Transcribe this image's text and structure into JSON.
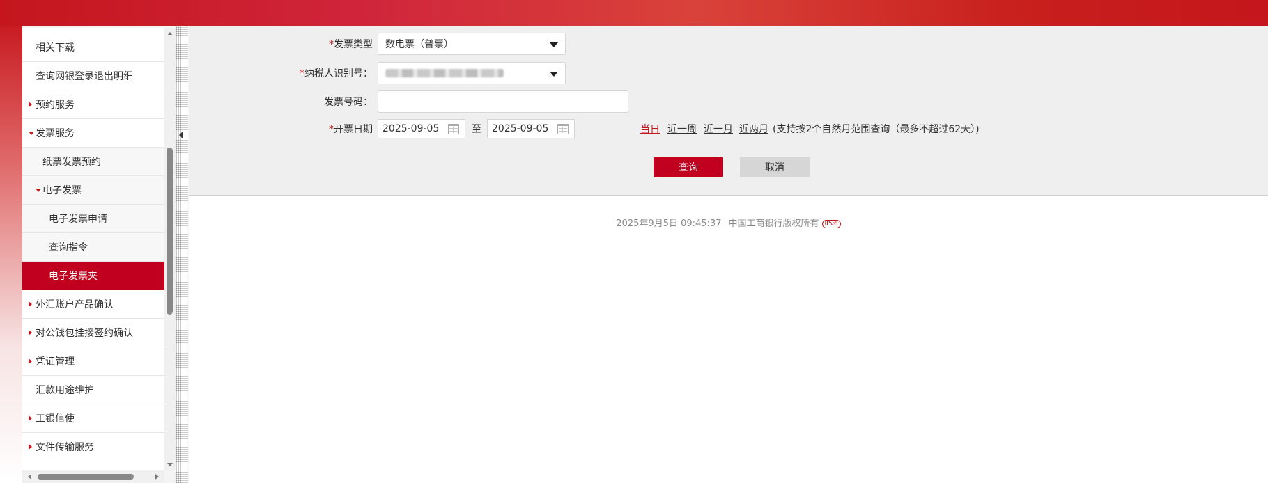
{
  "sidebar": {
    "items": [
      {
        "label": "相关下载",
        "arrow": "none",
        "level": 0
      },
      {
        "label": "查询网银登录退出明细",
        "arrow": "none",
        "level": 0
      },
      {
        "label": "预约服务",
        "arrow": "right",
        "level": 0
      },
      {
        "label": "发票服务",
        "arrow": "down",
        "level": 0
      },
      {
        "label": "纸票发票预约",
        "arrow": "none",
        "level": 1
      },
      {
        "label": "电子发票",
        "arrow": "down",
        "level": 1
      },
      {
        "label": "电子发票申请",
        "arrow": "none",
        "level": 2
      },
      {
        "label": "查询指令",
        "arrow": "none",
        "level": 2
      },
      {
        "label": "电子发票夹",
        "arrow": "none",
        "level": 2,
        "active": true
      },
      {
        "label": "外汇账户产品确认",
        "arrow": "right",
        "level": 0
      },
      {
        "label": "对公钱包挂接签约确认",
        "arrow": "right",
        "level": 0
      },
      {
        "label": "凭证管理",
        "arrow": "right",
        "level": 0
      },
      {
        "label": "汇款用途维护",
        "arrow": "none",
        "level": 0
      },
      {
        "label": "工银信使",
        "arrow": "right",
        "level": 0
      },
      {
        "label": "文件传输服务",
        "arrow": "right",
        "level": 0
      }
    ]
  },
  "form": {
    "required_mark": "*",
    "invoice_type": {
      "label": "发票类型",
      "value": "数电票（普票）"
    },
    "tax_id": {
      "label": "纳税人识别号：",
      "value": ""
    },
    "invoice_number": {
      "label": "发票号码：",
      "value": ""
    },
    "issue_date": {
      "label": "开票日期",
      "start": "2025-09-05",
      "separator": "至",
      "end": "2025-09-05",
      "quick_links": [
        "当日",
        "近一周",
        "近一月",
        "近两月"
      ],
      "hint": "(支持按2个自然月范围查询（最多不超过62天）)"
    },
    "query_button": "查询",
    "cancel_button": "取消"
  },
  "footer": {
    "datetime": "2025年9月5日 09:45:37",
    "copyright": "中国工商银行版权所有",
    "ipv6_badge": "IPv6"
  },
  "colors": {
    "brand_red": "#c1001f",
    "banner_red": "#c4161c",
    "link_active": "#c8161d"
  }
}
